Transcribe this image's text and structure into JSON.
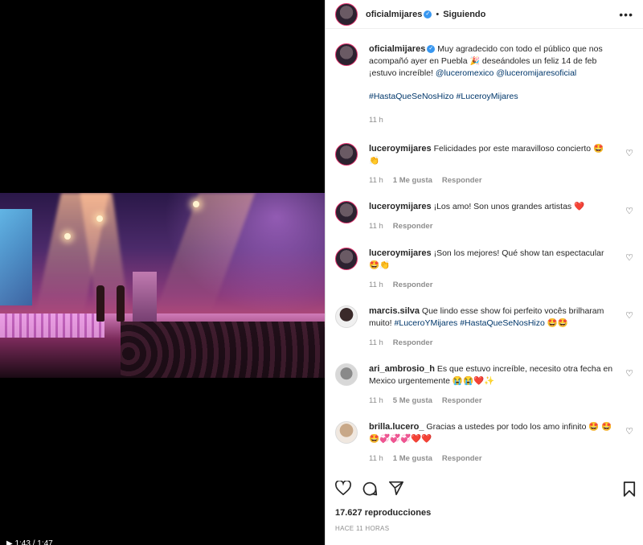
{
  "post": {
    "username": "oficialmijares",
    "follow_status": "Siguiendo",
    "more_label": "•••",
    "caption": {
      "text_before": "Muy agradecido con todo el público que nos acompañó ayer en Puebla ",
      "text_mid": " deseándoles un feliz 14 de feb ¡estuvo increíble! ",
      "mention1": "@luceromexico",
      "mention2": "@luceromijaresoficial",
      "hashtags": "#HastaQueSeNosHizo #LuceroyMijares",
      "time": "11 h",
      "emoji": "🎉"
    }
  },
  "video": {
    "playbar_text": "▶  1:43 / 1:47"
  },
  "comments": [
    {
      "user": "luceroymijares",
      "text": "Felicidades por este maravilloso concierto 🤩 👏",
      "time": "11 h",
      "likes": "1 Me gusta",
      "reply": "Responder"
    },
    {
      "user": "luceroymijares",
      "text": "¡Los amo! Son unos grandes artistas ❤️",
      "time": "11 h",
      "likes": "",
      "reply": "Responder"
    },
    {
      "user": "luceroymijares",
      "text": "¡Son los mejores! Qué show tan espectacular 🤩👏",
      "time": "11 h",
      "likes": "",
      "reply": "Responder"
    },
    {
      "user": "marcis.silva",
      "text_plain": "Que lindo esse show foi perfeito vocês brilharam muito! ",
      "tags": "#LuceroYMijares #HastaQueSeNosHizo",
      "emoji": " 🤩🤩",
      "time": "11 h",
      "likes": "",
      "reply": "Responder"
    },
    {
      "user": "ari_ambrosio_h",
      "text": "Es que estuvo increíble, necesito otra fecha en Mexico urgentemente 😭😭❤️✨",
      "time": "11 h",
      "likes": "5 Me gusta",
      "reply": "Responder"
    },
    {
      "user": "brilla.lucero_",
      "text": "Gracias a ustedes por todo los amo infinito 🤩 🤩🤩💞💞💞❤️❤️",
      "time": "11 h",
      "likes": "1 Me gusta",
      "reply": "Responder"
    }
  ],
  "footer": {
    "views": "17.627 reproducciones",
    "ago": "HACE 11 HORAS"
  },
  "icons": {
    "like": "heart-icon",
    "comment": "comment-icon",
    "share": "share-icon",
    "save": "bookmark-icon"
  }
}
